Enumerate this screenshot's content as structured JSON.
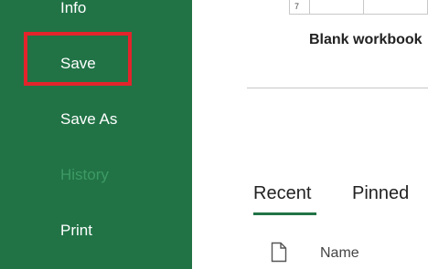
{
  "sidebar": {
    "items": [
      {
        "label": "Info"
      },
      {
        "label": "Save"
      },
      {
        "label": "Save As"
      },
      {
        "label": "History"
      },
      {
        "label": "Print"
      }
    ]
  },
  "main": {
    "thumbnail_row_number": "7",
    "blank_workbook_label": "Blank workbook",
    "tabs": [
      {
        "label": "Recent"
      },
      {
        "label": "Pinned"
      }
    ],
    "columns": {
      "name_header": "Name"
    }
  },
  "colors": {
    "sidebar_bg": "#217346",
    "highlight_border": "#e3242b",
    "disabled_text": "#3d9a63"
  }
}
